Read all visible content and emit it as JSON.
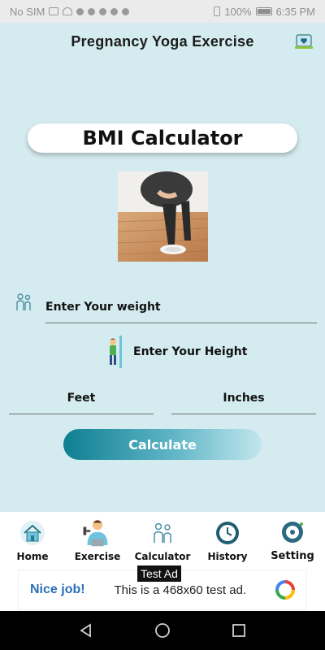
{
  "status_bar": {
    "carrier": "No SIM",
    "battery": "100%",
    "time": "6:35 PM"
  },
  "app": {
    "title": "Pregnancy Yoga Exercise"
  },
  "header_icon": "heart-screen-icon",
  "bmi": {
    "title": "BMI Calculator",
    "weight_placeholder": "Enter Your weight",
    "height_label": "Enter Your Height",
    "feet_placeholder": "Feet",
    "inches_placeholder": "Inches",
    "calculate_label": "Calculate"
  },
  "nav": {
    "items": [
      {
        "label": "Home",
        "icon": "home-icon"
      },
      {
        "label": "Exercise",
        "icon": "exercise-icon"
      },
      {
        "label": "Calculator",
        "icon": "calculator-icon"
      },
      {
        "label": "History",
        "icon": "history-icon"
      },
      {
        "label": "Setting",
        "icon": "setting-icon"
      }
    ]
  },
  "ad": {
    "tag": "Test Ad",
    "headline": "Nice job!",
    "text": "This is a 468x60 test ad."
  },
  "colors": {
    "background": "#d4ebef",
    "accent": "#0f7f92"
  }
}
